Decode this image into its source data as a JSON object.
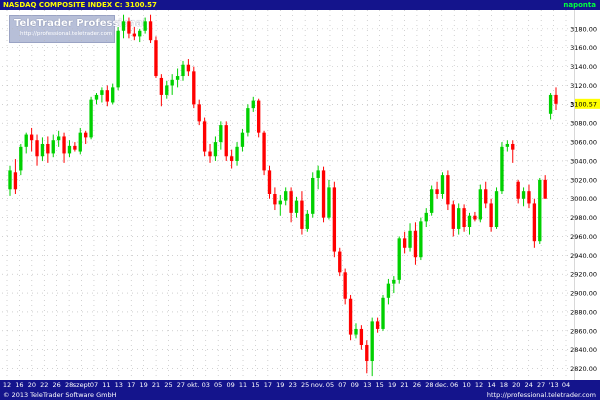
{
  "header": {
    "title": "NASDAQ COMPOSITE INDEX C: 3100.57",
    "period": "naponta"
  },
  "watermark": {
    "name": "TeleTrader Professional",
    "url": "http://professional.teletrader.com"
  },
  "footer": {
    "copyright": "© 2013 TeleTrader Software GmbH",
    "url": "http://professional.teletrader.com"
  },
  "colors": {
    "up": "#00d000",
    "down": "#ff0000",
    "bar_background": "#14148c",
    "title_text": "#ffff00",
    "period_text": "#00ff40",
    "last_price_tag": "#ffff00",
    "grid": "#b4b4b4"
  },
  "chart_data": {
    "type": "candlestick",
    "title": "NASDAQ COMPOSITE INDEX C: 3100.57",
    "ylim": [
      2810,
      3200
    ],
    "y_ticks": [
      2820,
      2840,
      2860,
      2880,
      2900,
      2920,
      2940,
      2960,
      2980,
      3000,
      3020,
      3040,
      3060,
      3080,
      3100,
      3120,
      3140,
      3160,
      3180
    ],
    "y_scale": "linear",
    "grid": true,
    "last_price": 3100.57,
    "x_tick_labels": [
      "12",
      "16",
      "20",
      "22",
      "26",
      "28",
      "szept",
      "07",
      "11",
      "13",
      "17",
      "19",
      "21",
      "25",
      "27",
      "okt.",
      "03",
      "05",
      "09",
      "11",
      "15",
      "17",
      "19",
      "23",
      "25",
      "nov.",
      "05",
      "07",
      "09",
      "13",
      "15",
      "19",
      "21",
      "26",
      "28",
      "dec.",
      "06",
      "10",
      "12",
      "14",
      "18",
      "20",
      "24",
      "27",
      "'13",
      "04"
    ],
    "candles": [
      {
        "o": 3010,
        "h": 3035,
        "l": 3003,
        "c": 3030
      },
      {
        "o": 3028,
        "h": 3042,
        "l": 3005,
        "c": 3010
      },
      {
        "o": 3030,
        "h": 3058,
        "l": 3025,
        "c": 3055
      },
      {
        "o": 3055,
        "h": 3070,
        "l": 3048,
        "c": 3068
      },
      {
        "o": 3068,
        "h": 3075,
        "l": 3050,
        "c": 3062
      },
      {
        "o": 3062,
        "h": 3068,
        "l": 3035,
        "c": 3045
      },
      {
        "o": 3045,
        "h": 3065,
        "l": 3040,
        "c": 3058
      },
      {
        "o": 3058,
        "h": 3066,
        "l": 3038,
        "c": 3048
      },
      {
        "o": 3048,
        "h": 3068,
        "l": 3044,
        "c": 3062
      },
      {
        "o": 3062,
        "h": 3072,
        "l": 3055,
        "c": 3066
      },
      {
        "o": 3066,
        "h": 3070,
        "l": 3038,
        "c": 3048
      },
      {
        "o": 3048,
        "h": 3062,
        "l": 3044,
        "c": 3056
      },
      {
        "o": 3056,
        "h": 3060,
        "l": 3050,
        "c": 3052
      },
      {
        "o": 3050,
        "h": 3075,
        "l": 3047,
        "c": 3070
      },
      {
        "o": 3070,
        "h": 3072,
        "l": 3058,
        "c": 3065
      },
      {
        "o": 3065,
        "h": 3108,
        "l": 3063,
        "c": 3105
      },
      {
        "o": 3105,
        "h": 3112,
        "l": 3100,
        "c": 3110
      },
      {
        "o": 3110,
        "h": 3118,
        "l": 3102,
        "c": 3115
      },
      {
        "o": 3115,
        "h": 3120,
        "l": 3098,
        "c": 3103
      },
      {
        "o": 3102,
        "h": 3122,
        "l": 3100,
        "c": 3118
      },
      {
        "o": 3118,
        "h": 3182,
        "l": 3115,
        "c": 3178
      },
      {
        "o": 3178,
        "h": 3195,
        "l": 3170,
        "c": 3188
      },
      {
        "o": 3188,
        "h": 3192,
        "l": 3170,
        "c": 3175
      },
      {
        "o": 3175,
        "h": 3182,
        "l": 3168,
        "c": 3172
      },
      {
        "o": 3172,
        "h": 3180,
        "l": 3166,
        "c": 3178
      },
      {
        "o": 3178,
        "h": 3192,
        "l": 3175,
        "c": 3188
      },
      {
        "o": 3188,
        "h": 3195,
        "l": 3165,
        "c": 3168
      },
      {
        "o": 3168,
        "h": 3172,
        "l": 3128,
        "c": 3130
      },
      {
        "o": 3128,
        "h": 3132,
        "l": 3098,
        "c": 3110
      },
      {
        "o": 3110,
        "h": 3125,
        "l": 3106,
        "c": 3120
      },
      {
        "o": 3120,
        "h": 3132,
        "l": 3110,
        "c": 3126
      },
      {
        "o": 3126,
        "h": 3138,
        "l": 3118,
        "c": 3130
      },
      {
        "o": 3130,
        "h": 3146,
        "l": 3125,
        "c": 3142
      },
      {
        "o": 3142,
        "h": 3148,
        "l": 3130,
        "c": 3135
      },
      {
        "o": 3135,
        "h": 3140,
        "l": 3096,
        "c": 3100
      },
      {
        "o": 3100,
        "h": 3105,
        "l": 3078,
        "c": 3082
      },
      {
        "o": 3082,
        "h": 3086,
        "l": 3045,
        "c": 3050
      },
      {
        "o": 3050,
        "h": 3058,
        "l": 3038,
        "c": 3045
      },
      {
        "o": 3045,
        "h": 3066,
        "l": 3040,
        "c": 3060
      },
      {
        "o": 3060,
        "h": 3082,
        "l": 3052,
        "c": 3078
      },
      {
        "o": 3078,
        "h": 3082,
        "l": 3040,
        "c": 3045
      },
      {
        "o": 3045,
        "h": 3052,
        "l": 3032,
        "c": 3040
      },
      {
        "o": 3040,
        "h": 3060,
        "l": 3035,
        "c": 3055
      },
      {
        "o": 3055,
        "h": 3074,
        "l": 3050,
        "c": 3070
      },
      {
        "o": 3070,
        "h": 3100,
        "l": 3066,
        "c": 3096
      },
      {
        "o": 3096,
        "h": 3108,
        "l": 3092,
        "c": 3104
      },
      {
        "o": 3104,
        "h": 3106,
        "l": 3065,
        "c": 3070
      },
      {
        "o": 3070,
        "h": 3072,
        "l": 3025,
        "c": 3030
      },
      {
        "o": 3030,
        "h": 3035,
        "l": 3000,
        "c": 3005
      },
      {
        "o": 3005,
        "h": 3012,
        "l": 2988,
        "c": 2994
      },
      {
        "o": 2994,
        "h": 3004,
        "l": 2982,
        "c": 2998
      },
      {
        "o": 2998,
        "h": 3012,
        "l": 2993,
        "c": 3008
      },
      {
        "o": 3008,
        "h": 3012,
        "l": 2975,
        "c": 2985
      },
      {
        "o": 2985,
        "h": 3002,
        "l": 2980,
        "c": 2998
      },
      {
        "o": 2998,
        "h": 3008,
        "l": 2962,
        "c": 2968
      },
      {
        "o": 2968,
        "h": 2988,
        "l": 2965,
        "c": 2984
      },
      {
        "o": 2984,
        "h": 3028,
        "l": 2980,
        "c": 3022
      },
      {
        "o": 3022,
        "h": 3035,
        "l": 3010,
        "c": 3030
      },
      {
        "o": 3030,
        "h": 3034,
        "l": 2975,
        "c": 2980
      },
      {
        "o": 2980,
        "h": 3020,
        "l": 2978,
        "c": 3012
      },
      {
        "o": 3012,
        "h": 3018,
        "l": 2938,
        "c": 2944
      },
      {
        "o": 2944,
        "h": 2948,
        "l": 2918,
        "c": 2922
      },
      {
        "o": 2922,
        "h": 2926,
        "l": 2888,
        "c": 2894
      },
      {
        "o": 2894,
        "h": 2898,
        "l": 2850,
        "c": 2856
      },
      {
        "o": 2856,
        "h": 2868,
        "l": 2852,
        "c": 2862
      },
      {
        "o": 2862,
        "h": 2866,
        "l": 2840,
        "c": 2845
      },
      {
        "o": 2845,
        "h": 2850,
        "l": 2815,
        "c": 2828
      },
      {
        "o": 2828,
        "h": 2874,
        "l": 2812,
        "c": 2870
      },
      {
        "o": 2870,
        "h": 2874,
        "l": 2858,
        "c": 2862
      },
      {
        "o": 2862,
        "h": 2898,
        "l": 2860,
        "c": 2895
      },
      {
        "o": 2895,
        "h": 2915,
        "l": 2888,
        "c": 2910
      },
      {
        "o": 2910,
        "h": 2918,
        "l": 2900,
        "c": 2914
      },
      {
        "o": 2914,
        "h": 2960,
        "l": 2910,
        "c": 2958
      },
      {
        "o": 2958,
        "h": 2965,
        "l": 2942,
        "c": 2948
      },
      {
        "o": 2948,
        "h": 2974,
        "l": 2944,
        "c": 2966
      },
      {
        "o": 2966,
        "h": 2975,
        "l": 2930,
        "c": 2938
      },
      {
        "o": 2938,
        "h": 2980,
        "l": 2935,
        "c": 2976
      },
      {
        "o": 2976,
        "h": 2990,
        "l": 2970,
        "c": 2985
      },
      {
        "o": 2985,
        "h": 3014,
        "l": 2982,
        "c": 3010
      },
      {
        "o": 3010,
        "h": 3018,
        "l": 3000,
        "c": 3005
      },
      {
        "o": 3005,
        "h": 3028,
        "l": 3000,
        "c": 3025
      },
      {
        "o": 3025,
        "h": 3030,
        "l": 2988,
        "c": 2994
      },
      {
        "o": 2994,
        "h": 2998,
        "l": 2960,
        "c": 2968
      },
      {
        "o": 2968,
        "h": 2995,
        "l": 2962,
        "c": 2990
      },
      {
        "o": 2990,
        "h": 2994,
        "l": 2965,
        "c": 2970
      },
      {
        "o": 2970,
        "h": 2985,
        "l": 2962,
        "c": 2982
      },
      {
        "o": 2982,
        "h": 2986,
        "l": 2976,
        "c": 2978
      },
      {
        "o": 2978,
        "h": 3015,
        "l": 2975,
        "c": 3010
      },
      {
        "o": 3010,
        "h": 3018,
        "l": 2990,
        "c": 2995
      },
      {
        "o": 2995,
        "h": 3000,
        "l": 2965,
        "c": 2970
      },
      {
        "o": 2970,
        "h": 3012,
        "l": 2968,
        "c": 3008
      },
      {
        "o": 3008,
        "h": 3060,
        "l": 3005,
        "c": 3055
      },
      {
        "o": 3055,
        "h": 3062,
        "l": 3050,
        "c": 3058
      },
      {
        "o": 3058,
        "h": 3062,
        "l": 3038,
        "c": 3052
      },
      {
        "o": 3018,
        "h": 3020,
        "l": 2995,
        "c": 3000
      },
      {
        "o": 3000,
        "h": 3012,
        "l": 2992,
        "c": 3008
      },
      {
        "o": 3008,
        "h": 3015,
        "l": 2990,
        "c": 2995
      },
      {
        "o": 2995,
        "h": 3000,
        "l": 2948,
        "c": 2955
      },
      {
        "o": 2955,
        "h": 3022,
        "l": 2952,
        "c": 3020
      },
      {
        "o": 3020,
        "h": 3025,
        "l": 3000,
        "c": 3000
      },
      {
        "o": 3090,
        "h": 3112,
        "l": 3084,
        "c": 3110
      },
      {
        "o": 3110,
        "h": 3118,
        "l": 3094,
        "c": 3100.57
      }
    ]
  }
}
